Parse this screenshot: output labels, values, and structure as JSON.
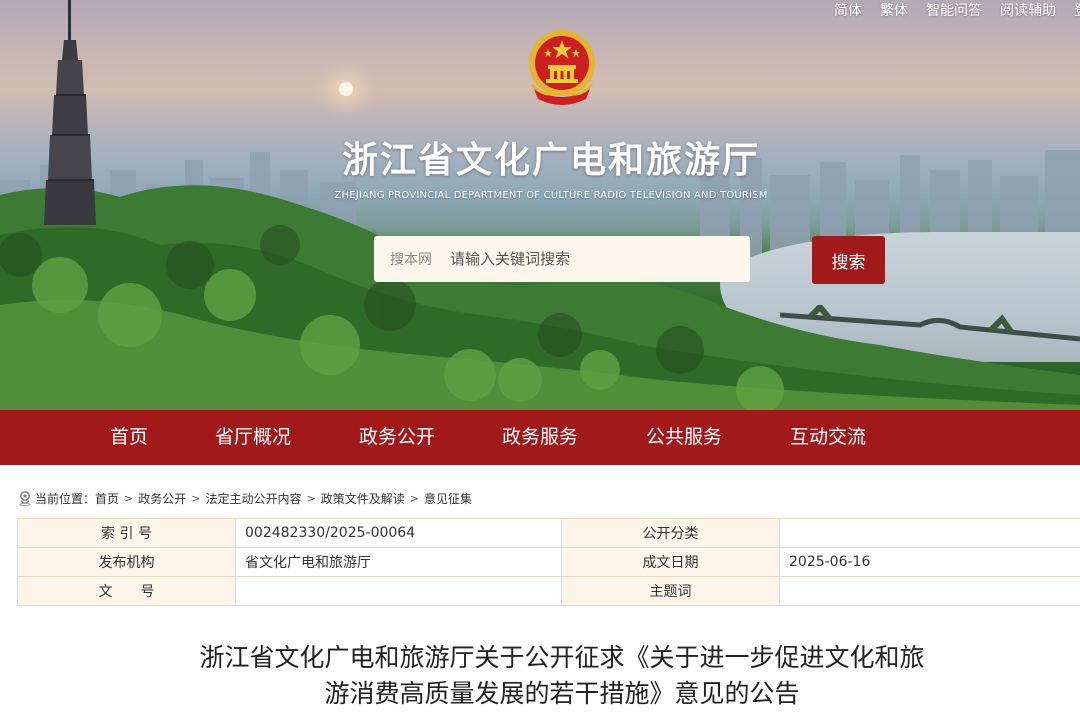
{
  "topbar": {
    "simplified": "简体",
    "traditional": "繁体",
    "smart_qa": "智能问答",
    "reading_aid": "阅读辅助",
    "login": "登"
  },
  "header": {
    "title": "浙江省文化广电和旅游厅",
    "subtitle": "ZHEJIANG PROVINCIAL DEPARTMENT OF CULTURE RADIO TELEVISION AND TOURISM",
    "emblem_icon": "national-emblem-icon"
  },
  "search": {
    "scope_label": "搜本网",
    "placeholder": "请输入关键词搜索",
    "button_label": "搜索"
  },
  "nav": {
    "items": [
      {
        "label": "首页"
      },
      {
        "label": "省厅概况"
      },
      {
        "label": "政务公开"
      },
      {
        "label": "政务服务"
      },
      {
        "label": "公共服务"
      },
      {
        "label": "互动交流"
      }
    ]
  },
  "breadcrumb": {
    "prefix": "当前位置：",
    "items": [
      "首页",
      "政务公开",
      "法定主动公开内容",
      "政策文件及解读",
      "意见征集"
    ],
    "separator": ">"
  },
  "info": {
    "index_label": "索 引 号",
    "index_value": "002482330/2025-00064",
    "category_label": "公开分类",
    "category_value": "",
    "publisher_label": "发布机构",
    "publisher_value": "省文化广电和旅游厅",
    "date_label": "成文日期",
    "date_value": "2025-06-16",
    "doc_no_label": "文　　号",
    "doc_no_value": "",
    "subject_label": "主题词",
    "subject_value": ""
  },
  "article": {
    "title_line1": "浙江省文化广电和旅游厅关于公开征求《关于进一步促进文化和旅",
    "title_line2": "游消费高质量发展的若干措施》意见的公告"
  },
  "colors": {
    "brand_red": "#a2191b",
    "table_label_bg": "#fdf4ea",
    "table_border": "#e8d8c4"
  }
}
